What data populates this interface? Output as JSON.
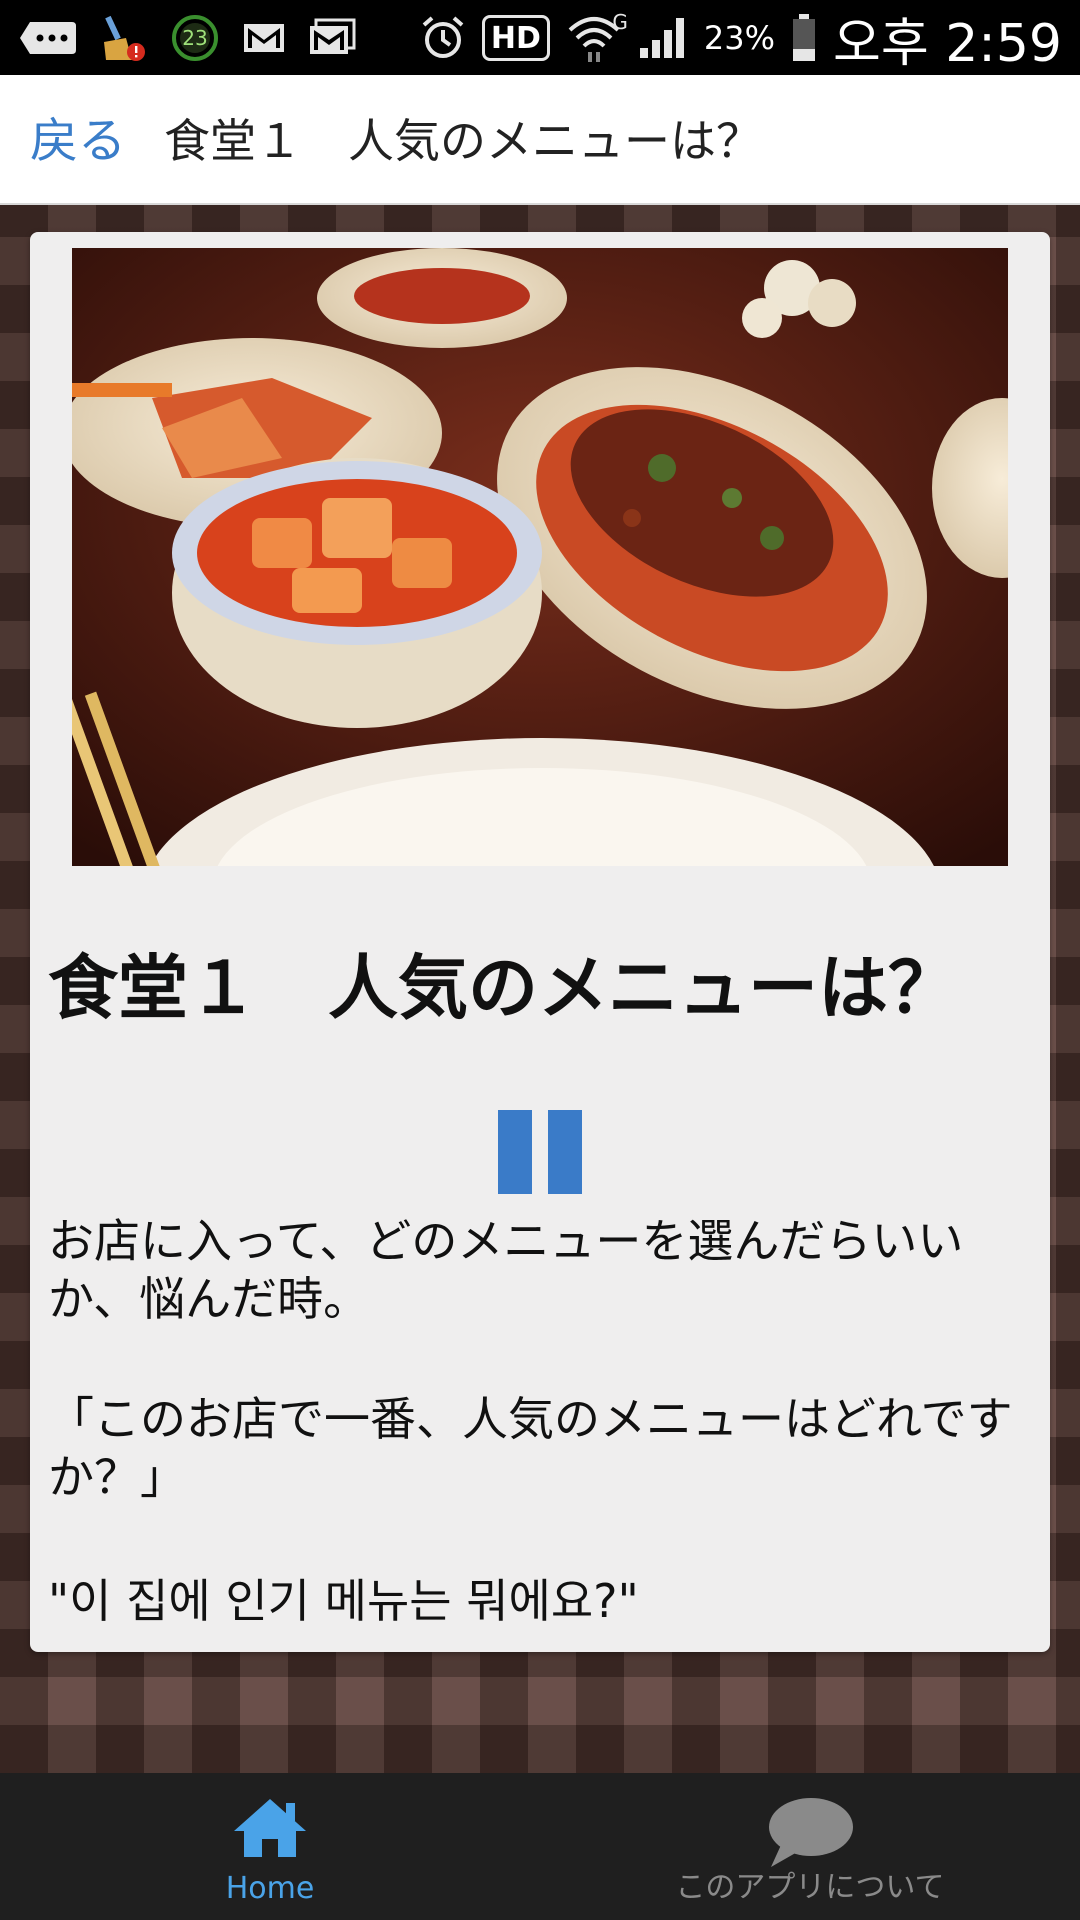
{
  "status_bar": {
    "notification_count": "23",
    "battery": "23%",
    "time": "오후 2:59",
    "network": "HD",
    "signal_tag": "G"
  },
  "header": {
    "back_label": "戻る",
    "title": "食堂１　人気のメニューは？"
  },
  "card": {
    "photo_alt": "",
    "title": "食堂１　人気のメニューは？",
    "paragraph1": "お店に入って、どのメニューを選んだらいいか、悩んだ時。",
    "paragraph2": "「このお店で一番、人気のメニューはどれですか？」",
    "korean_phrase": "\"이 집에 인기 메뉴는 뭐에요?\""
  },
  "bottom_nav": {
    "home_label": "Home",
    "about_label": "このアプリについて"
  },
  "colors": {
    "accent": "#3a7dc9",
    "nav_active": "#4aa3e8",
    "nav_inactive": "#8a8a8a"
  }
}
